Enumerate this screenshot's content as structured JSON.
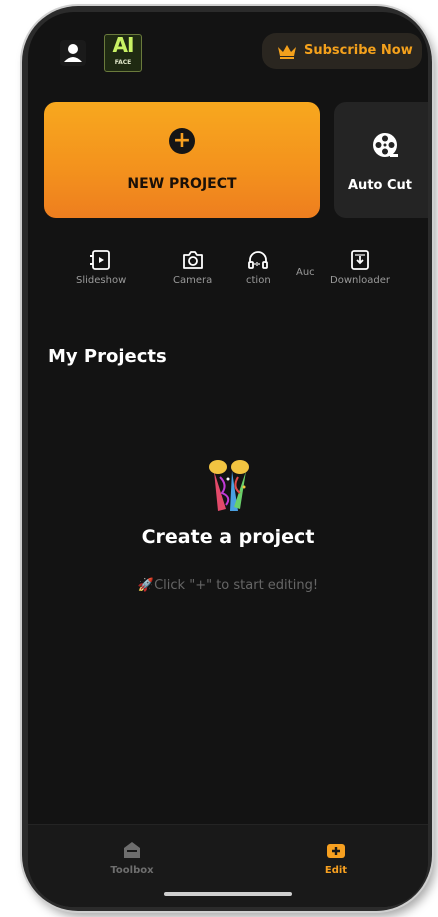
{
  "header": {
    "logo_text": "AI",
    "logo_subtext": "FACE",
    "subscribe_label": "Subscribe Now"
  },
  "actions": {
    "new_project_label": "NEW PROJECT",
    "auto_cut_label": "Auto Cut"
  },
  "tools": [
    {
      "label": "Slideshow",
      "icon": "slideshow-icon"
    },
    {
      "label": "Camera",
      "icon": "camera-icon"
    },
    {
      "label": "ction",
      "icon": "headphones-icon"
    },
    {
      "label": "Auc",
      "icon": "audio-icon"
    },
    {
      "label": "Downloader",
      "icon": "downloader-icon"
    }
  ],
  "projects": {
    "title": "My Projects",
    "empty_title": "Create a project",
    "empty_subtitle": "🚀Click \"+\" to start editing!"
  },
  "bottom_nav": [
    {
      "label": "Toolbox",
      "icon": "toolbox-icon",
      "active": false
    },
    {
      "label": "Edit",
      "icon": "edit-video-icon",
      "active": true
    }
  ],
  "colors": {
    "accent": "#f7a020",
    "background": "#131313",
    "card": "#242424",
    "inactive_nav": "#7a7a7a"
  }
}
